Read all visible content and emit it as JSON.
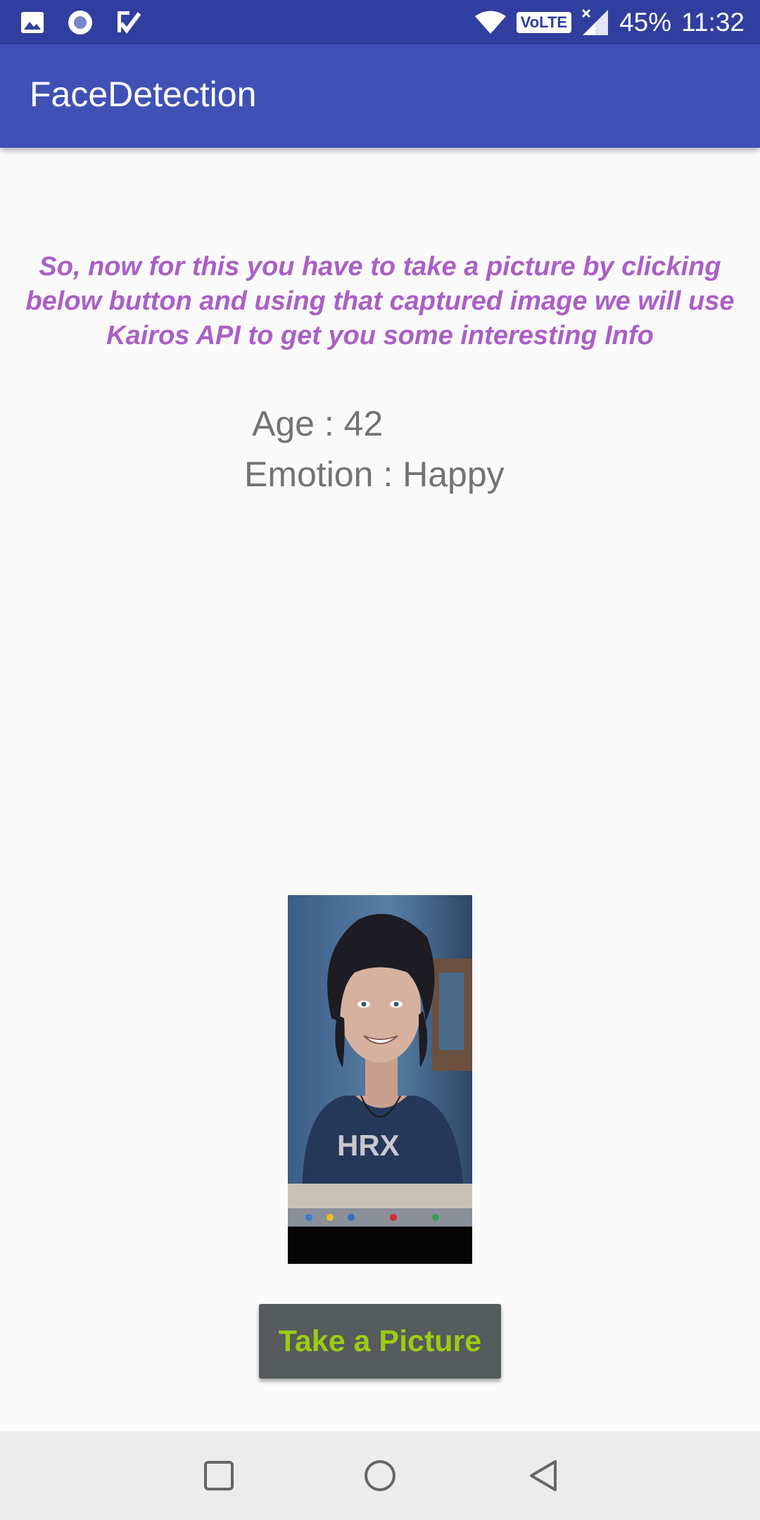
{
  "status_bar": {
    "battery": "45%",
    "time": "11:32",
    "network_badge": "VoLTE",
    "left_icons": [
      "image-icon",
      "record-icon",
      "task-check-icon"
    ],
    "right_icons": [
      "wifi-icon",
      "volte-icon",
      "signal-icon",
      "battery-icon"
    ]
  },
  "app_bar": {
    "title": "FaceDetection",
    "color": "#3f51b5"
  },
  "main": {
    "instructions": "So, now for this you have to take a picture by clicking below button and using that captured image we will use Kairos API to get you some interesting Info",
    "instructions_color": "#ab5fc6",
    "age": "Age : 42",
    "emotion": "Emotion : Happy",
    "photo_shirt_text": "HRX",
    "take_picture_label": "Take a Picture",
    "button_text_color": "#9acd12"
  },
  "nav_bar": {
    "icons": [
      "recents-icon",
      "home-icon",
      "back-icon"
    ]
  }
}
